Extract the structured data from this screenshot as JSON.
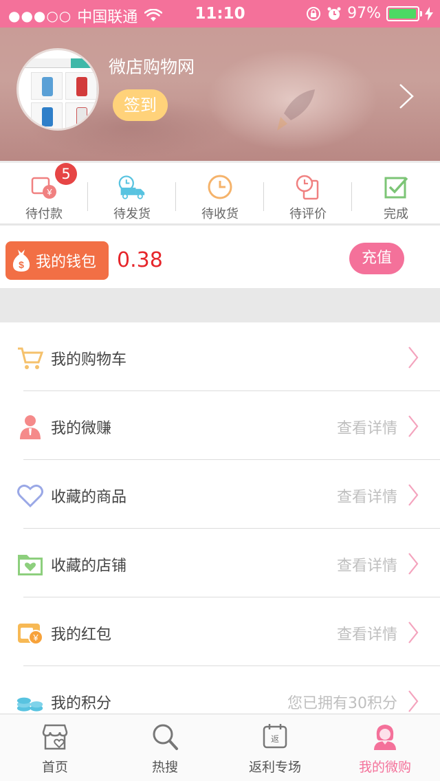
{
  "status_bar": {
    "signal": "●●●○○",
    "carrier": "中国联通",
    "time": "11:10",
    "battery": "97%",
    "battery_level": 0.97
  },
  "profile": {
    "name": "微店购物网",
    "signin_label": "签到"
  },
  "orders": [
    {
      "label": "待付款",
      "icon": "wallet-yen-icon",
      "badge": "5"
    },
    {
      "label": "待发货",
      "icon": "delivery-truck-icon"
    },
    {
      "label": "待收货",
      "icon": "clock-icon"
    },
    {
      "label": "待评价",
      "icon": "review-clock-icon"
    },
    {
      "label": "完成",
      "icon": "check-icon"
    }
  ],
  "wallet": {
    "label": "我的钱包",
    "balance": "0.38",
    "recharge_label": "充值"
  },
  "menu": [
    {
      "label": "我的购物车",
      "value": "",
      "icon": "cart-icon"
    },
    {
      "label": "我的微赚",
      "value": "查看详情",
      "icon": "person-icon"
    },
    {
      "label": "收藏的商品",
      "value": "查看详情",
      "icon": "heart-icon"
    },
    {
      "label": "收藏的店铺",
      "value": "查看详情",
      "icon": "folder-heart-icon"
    },
    {
      "label": "我的红包",
      "value": "查看详情",
      "icon": "red-packet-icon"
    },
    {
      "label": "我的积分",
      "value": "您已拥有30积分",
      "icon": "coins-icon"
    }
  ],
  "tabs": [
    {
      "label": "首页",
      "icon": "shop-heart-icon",
      "active": false
    },
    {
      "label": "热搜",
      "icon": "search-icon",
      "active": false
    },
    {
      "label": "返利专场",
      "icon": "rebate-calendar-icon",
      "active": false
    },
    {
      "label": "我的微购",
      "icon": "user-girl-icon",
      "active": true
    }
  ],
  "colors": {
    "brand": "#f4719a",
    "wallet": "#f26f45",
    "balance": "#e6262b",
    "signin": "#ffd27a"
  }
}
